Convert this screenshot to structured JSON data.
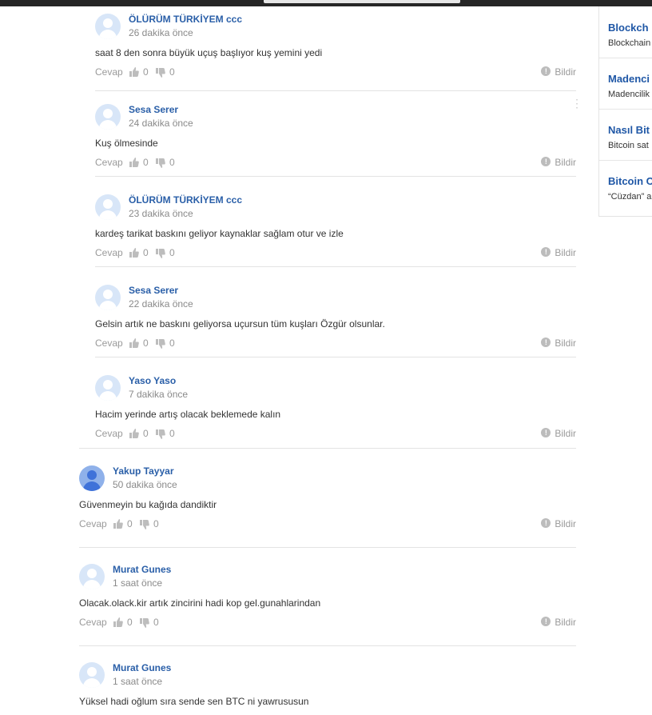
{
  "comments": [
    {
      "author": "ÖLÜRÜM TÜRKİYEM ccc",
      "time": "26 dakika önce",
      "text": "saat 8 den sonra büyük uçuş başlıyor kuş yemini yedi",
      "reply_label": "Cevap",
      "likes": "0",
      "dislikes": "0",
      "report_label": "Bildir"
    },
    {
      "author": "Sesa Serer",
      "time": "24 dakika önce",
      "text": "Kuş ölmesinde",
      "reply_label": "Cevap",
      "likes": "0",
      "dislikes": "0",
      "report_label": "Bildir"
    },
    {
      "author": "ÖLÜRÜM TÜRKİYEM ccc",
      "time": "23 dakika önce",
      "text": "kardeş tarikat baskını geliyor kaynaklar sağlam otur ve izle",
      "reply_label": "Cevap",
      "likes": "0",
      "dislikes": "0",
      "report_label": "Bildir"
    },
    {
      "author": "Sesa Serer",
      "time": "22 dakika önce",
      "text": "Gelsin artık ne baskını geliyorsa uçursun tüm kuşları Özgür olsunlar.",
      "reply_label": "Cevap",
      "likes": "0",
      "dislikes": "0",
      "report_label": "Bildir"
    },
    {
      "author": "Yaso Yaso",
      "time": "7 dakika önce",
      "text": "Hacim yerinde artış olacak beklemede kalın",
      "reply_label": "Cevap",
      "likes": "0",
      "dislikes": "0",
      "report_label": "Bildir"
    },
    {
      "author": "Yakup Tayyar",
      "time": "50 dakika önce",
      "text": "Güvenmeyin bu kağıda dandiktir",
      "reply_label": "Cevap",
      "likes": "0",
      "dislikes": "0",
      "report_label": "Bildir"
    },
    {
      "author": "Murat Gunes",
      "time": "1 saat önce",
      "text": "Olacak.olack.kir artık zincirini hadi kop gel.gunahlarindan",
      "reply_label": "Cevap",
      "likes": "0",
      "dislikes": "0",
      "report_label": "Bildir"
    },
    {
      "author": "Murat Gunes",
      "time": "1 saat önce",
      "text": "Yüksel hadi oğlum sıra sende sen BTC ni yawrususun"
    }
  ],
  "sidebar": {
    "items": [
      {
        "title": "Blockch",
        "desc": "Blockchain"
      },
      {
        "title": "Madenci",
        "desc": "Madencilik"
      },
      {
        "title": "Nasıl Bit",
        "desc": "Bitcoin sat"
      },
      {
        "title": "Bitcoin C",
        "desc": "“Cüzdan” a"
      }
    ]
  },
  "colors": {
    "author": "#2a5fa8",
    "sidebar_title": "#1f57a6",
    "muted": "#8a8a8a",
    "topbar": "#262626"
  }
}
